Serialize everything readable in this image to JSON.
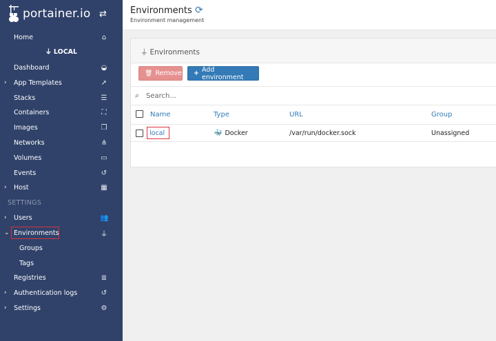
{
  "brand": {
    "name": "portainer.io"
  },
  "sidebar": {
    "home": "Home",
    "endpoint": "LOCAL",
    "items": [
      {
        "label": "Dashboard",
        "icon": "tachometer-icon"
      },
      {
        "label": "App Templates",
        "icon": "rocket-icon"
      },
      {
        "label": "Stacks",
        "icon": "list-icon"
      },
      {
        "label": "Containers",
        "icon": "cubes-icon"
      },
      {
        "label": "Images",
        "icon": "clone-icon"
      },
      {
        "label": "Networks",
        "icon": "sitemap-icon"
      },
      {
        "label": "Volumes",
        "icon": "hdd-icon"
      },
      {
        "label": "Events",
        "icon": "history-icon"
      },
      {
        "label": "Host",
        "icon": "th-icon"
      }
    ],
    "settings_section": "SETTINGS",
    "settings_items": [
      {
        "label": "Users",
        "icon": "users-icon"
      },
      {
        "label": "Environments",
        "icon": "plug-icon"
      },
      {
        "label": "Groups"
      },
      {
        "label": "Tags"
      },
      {
        "label": "Registries",
        "icon": "database-icon"
      },
      {
        "label": "Authentication logs",
        "icon": "history-icon"
      },
      {
        "label": "Settings",
        "icon": "cogs-icon"
      }
    ]
  },
  "header": {
    "title": "Environments",
    "subtitle": "Environment management"
  },
  "panel": {
    "title": "Environments",
    "remove_label": "Remove",
    "add_label": "Add environment",
    "search_placeholder": "Search...",
    "columns": [
      "Name",
      "Type",
      "URL",
      "Group"
    ],
    "rows": [
      {
        "name": "local",
        "type": "Docker",
        "url": "/var/run/docker.sock",
        "group": "Unassigned"
      }
    ]
  },
  "colors": {
    "sidebar_bg": "#30426a",
    "primary": "#337ab7",
    "danger": "#e59190",
    "highlight": "#d9333f"
  }
}
